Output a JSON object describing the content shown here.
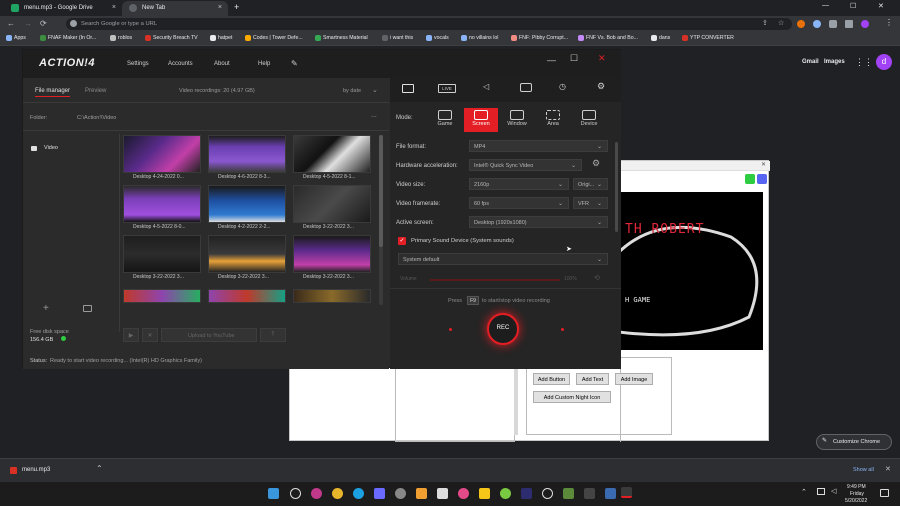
{
  "browser": {
    "tabs": [
      {
        "title": "menu.mp3 - Google Drive"
      },
      {
        "title": "New Tab"
      }
    ],
    "new_tab": "+",
    "tab_close": "×",
    "omnibox_placeholder": "Search Google or type a URL",
    "bookmarks": [
      "Apps",
      "FNAF Maker (In Or...",
      "roblos",
      "Security Breach TV",
      "hatpet",
      "Codes | Tower Defe...",
      "Smartness Material",
      "i want this",
      "vocals",
      "no villains lol",
      "FNF: Pibby Corrupt...",
      "FNF Vs. Bob and Bo...",
      "dans",
      "YTP CONVERTER"
    ],
    "window_controls": {
      "minimize": "—",
      "maximize": "☐",
      "close": "✕"
    },
    "ntp": {
      "gmail": "Gmail",
      "images": "Images",
      "avatar": "d",
      "customize": "Customize Chrome"
    }
  },
  "action": {
    "logo": "ACTION!4",
    "menu": [
      "Settings",
      "Accounts",
      "About",
      "Help"
    ],
    "file_manager_tab": "File manager",
    "preview_tab": "Preview",
    "recordings_summary": "Video recordings: 20 (4.97 GB)",
    "sort": "by date",
    "folder_label": "Folder:",
    "folder_path": "C:\\Action!\\Video",
    "folder_more": "...",
    "tree_item": "Video",
    "free_space_label": "Free disk space",
    "free_space_value": "156.4 GB",
    "upload_button": "Upload to YouTube",
    "status_label": "Status:",
    "status_text": "Ready to start video recording... (Intel(R) HD Graphics Family)",
    "thumbnails": [
      "Desktop 4-24-2022 0...",
      "Desktop 4-6-2022 8-3...",
      "Desktop 4-5-2022 8-1...",
      "Desktop 4-5-2022 8-0...",
      "Desktop 4-2-2022 2-2...",
      "Desktop 3-22-2022 3...",
      "Desktop 3-22-2022 3...",
      "Desktop 3-22-2022 3...",
      "Desktop 3-22-2022 3..."
    ],
    "live_label": "LIVE",
    "mode_label": "Mode:",
    "modes": [
      "Game",
      "Screen",
      "Window",
      "Area",
      "Device"
    ],
    "rows": {
      "file_format": {
        "label": "File format:",
        "value": "MP4"
      },
      "hw_accel": {
        "label": "Hardware acceleration:",
        "value": "Intel® Quick Sync Video"
      },
      "video_size": {
        "label": "Video size:",
        "value": "2160p",
        "extra": "Origi..."
      },
      "framerate": {
        "label": "Video framerate:",
        "value": "60 fps",
        "extra": "VFR"
      },
      "active_screen": {
        "label": "Active screen:",
        "value": "Desktop (1920x1080)"
      }
    },
    "primary_sound": "Primary Sound Device (System sounds)",
    "system_default": "System default",
    "volume_label": "Volume",
    "volume_value": "100%",
    "hint_press": "Press",
    "hint_key": "F9",
    "hint_rest": "to start/stop video recording",
    "rec": "REC"
  },
  "behind_dialog": {
    "overlay_text": "TH ROBERT",
    "overlay_text2": "H GAME",
    "buttons": [
      "Add Button",
      "Add Text",
      "Add Image",
      "Add Custom Night Icon"
    ]
  },
  "download": {
    "file": "menu.mp3",
    "show_all": "Show all"
  },
  "taskbar": {
    "time": "9:49 PM",
    "day": "Friday",
    "date": "5/20/2022"
  },
  "colors": {
    "accent_red": "#e31e24",
    "chrome_dark": "#202124",
    "action_bg": "#2b2b2b"
  }
}
